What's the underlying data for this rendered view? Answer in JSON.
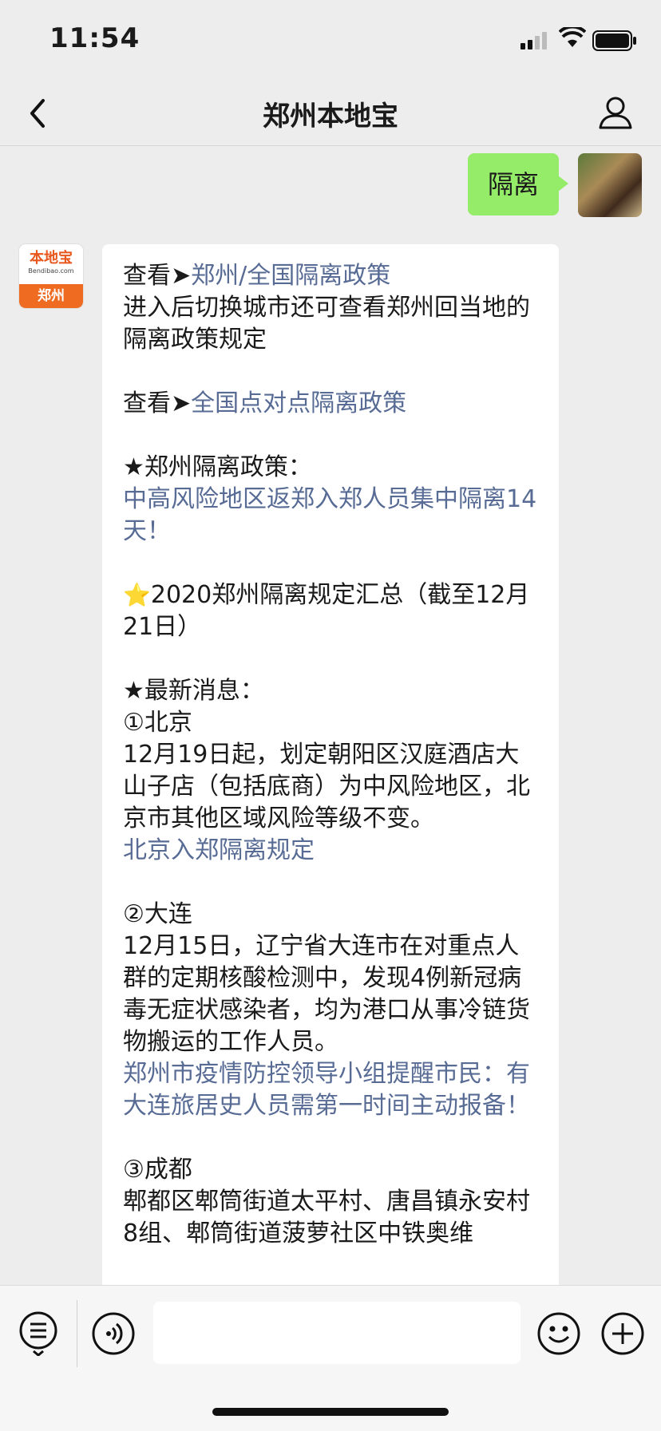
{
  "status": {
    "time": "11:54"
  },
  "nav": {
    "title": "郑州本地宝"
  },
  "user_message": "隔离",
  "bot_avatar": {
    "logo": "本地宝",
    "sub": "Bendibao.com",
    "city": "郑州"
  },
  "message": {
    "p1_prefix": "查看➤",
    "p1_link": "郑州/全国隔离政策",
    "p1_text": "进入后切换城市还可查看郑州回当地的隔离政策规定",
    "p2_prefix": "查看➤",
    "p2_link": "全国点对点隔离政策",
    "p3_heading": "★郑州隔离政策：",
    "p3_link": "中高风险地区返郑入郑人员集中隔离14天！",
    "p4_text": "2020郑州隔离规定汇总（截至12月21日）",
    "p5_heading": "★最新消息：",
    "b_title": "①北京",
    "b_text": "12月19日起，划定朝阳区汉庭酒店大山子店（包括底商）为中风险地区，北京市其他区域风险等级不变。",
    "b_link": "北京入郑隔离规定",
    "d_title": "②大连",
    "d_text": "12月15日，辽宁省大连市在对重点人群的定期核酸检测中，发现4例新冠病毒无症状感染者，均为港口从事冷链货物搬运的工作人员。",
    "d_link": "郑州市疫情防控领导小组提醒市民：有大连旅居史人员需第一时间主动报备！",
    "c_title": "③成都",
    "c_text": "郫都区郫筒街道太平村、唐昌镇永安村8组、郫筒街道菠萝社区中铁奥维"
  },
  "colors": {
    "link": "#576b95",
    "user_bubble": "#95ec69",
    "bg": "#ededed"
  }
}
